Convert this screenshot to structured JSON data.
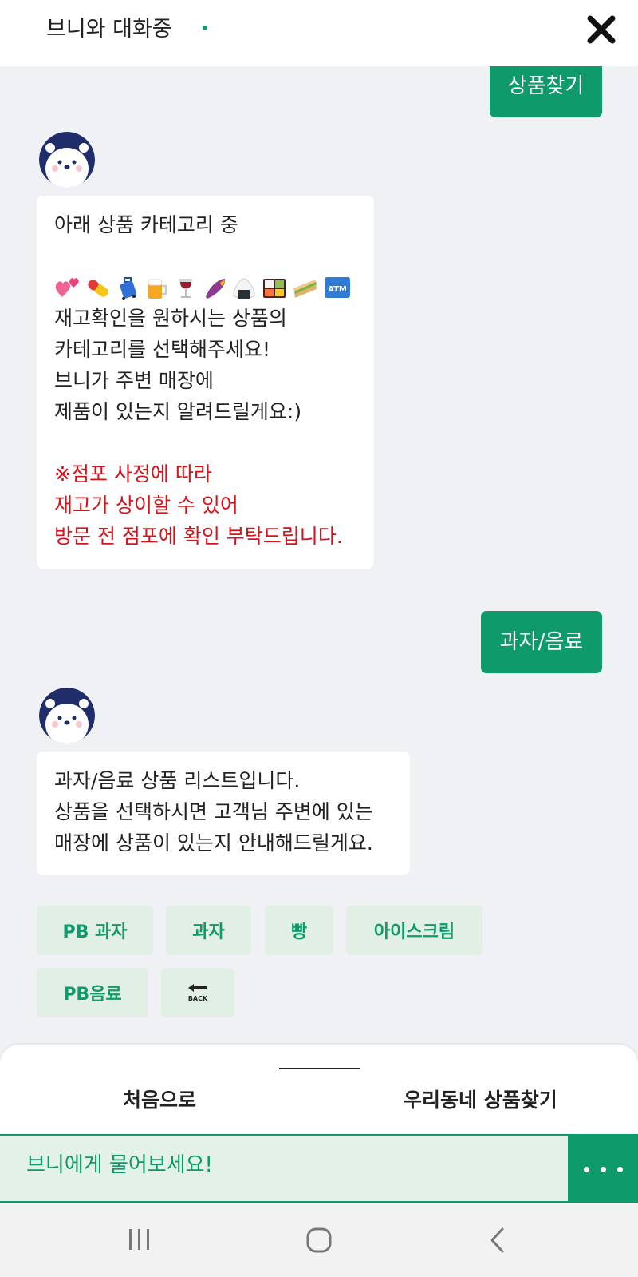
{
  "header": {
    "title": "브니와 대화중"
  },
  "messages": {
    "user1": "상품찾기",
    "bot1": {
      "line1": "아래 상품 카테고리 중",
      "line2": "재고확인을 원하시는 상품의",
      "line3": "카테고리를 선택해주세요!",
      "line4": "브니가 주변 매장에",
      "line5": "제품이 있는지 알려드릴게요:)",
      "notice1": "※점포 사정에 따라",
      "notice2": "재고가 상이할 수 있어",
      "notice3": "방문 전 점포에 확인 부탁드립니다.",
      "emoji_icons": [
        "two-hearts",
        "pill",
        "luggage",
        "beer-mug",
        "wine-glass",
        "sweet-potato",
        "rice-ball",
        "bento-box",
        "sandwich",
        "atm-sign"
      ],
      "atm_label": "ATM"
    },
    "user2": "과자/음료",
    "bot2": {
      "line1": "과자/음료 상품 리스트입니다.",
      "line2": "상품을 선택하시면 고객님 주변에 있는",
      "line3": "매장에 상품이 있는지 안내해드릴게요."
    }
  },
  "quick_replies": [
    "PB 과자",
    "과자",
    "빵",
    "아이스크림",
    "PB음료"
  ],
  "back_button": {
    "icon": "back-arrow-icon",
    "label": "BACK"
  },
  "bottom_panel": {
    "left_link": "처음으로",
    "right_link": "우리동네 상품찾기"
  },
  "input": {
    "placeholder": "브니에게 물어보세요!"
  },
  "colors": {
    "brand_green": "#0f9a6b",
    "notice_red": "#d4141a",
    "quick_reply_bg": "#e1efe5"
  }
}
